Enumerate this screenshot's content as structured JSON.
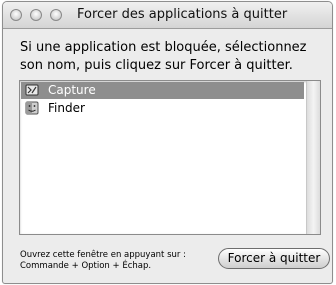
{
  "window": {
    "title": "Forcer des applications à quitter"
  },
  "message": "Si une application est bloquée, sélectionnez son nom, puis cliquez sur Forcer à quitter.",
  "apps": [
    {
      "name": "Capture",
      "icon": "capture-app-icon",
      "selected": true
    },
    {
      "name": "Finder",
      "icon": "finder-app-icon",
      "selected": false
    }
  ],
  "hint": {
    "line1": "Ouvrez cette fenêtre en appuyant sur :",
    "line2": "Commande + Option + Échap."
  },
  "force_quit_button": "Forcer à quitter",
  "colors": {
    "selection": "#8e8e8e",
    "window_background": "#ececec"
  }
}
